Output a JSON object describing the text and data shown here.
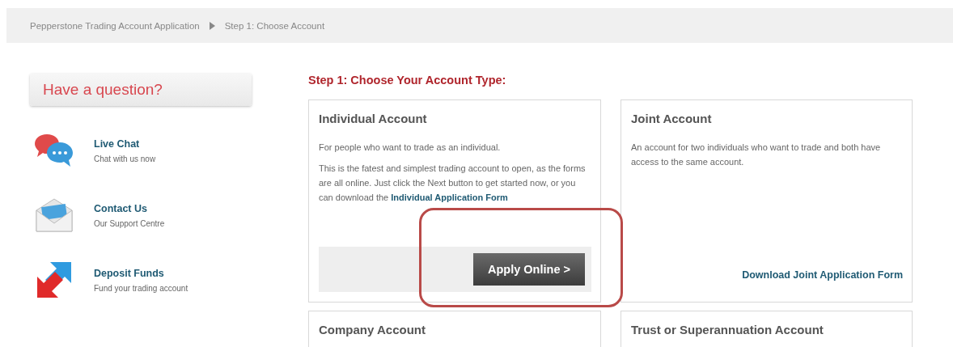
{
  "breadcrumb": [
    {
      "label": "Pepperstone Trading Account Application"
    },
    {
      "label": "Step 1: Choose Account"
    }
  ],
  "sidebar": {
    "title": "Have a question?",
    "items": [
      {
        "kind": "chat",
        "title": "Live Chat",
        "subtitle": "Chat with us now"
      },
      {
        "kind": "mail",
        "title": "Contact Us",
        "subtitle": "Our Support Centre"
      },
      {
        "kind": "transfer",
        "title": "Deposit Funds",
        "subtitle": "Fund your trading account"
      }
    ]
  },
  "heading": "Step 1: Choose Your Account Type:",
  "cards": [
    {
      "title": "Individual Account",
      "paragraphs": [
        {
          "text": "For people who want to trade as an individual."
        },
        {
          "text": "This is the fatest and simplest trading account to open, as the forms are all online. Just click the Next button to get started now, or you can download the",
          "link": "Individual Application Form"
        }
      ],
      "footer": {
        "kind": "button",
        "label": "Apply Online >"
      }
    },
    {
      "title": "Joint Account",
      "paragraphs": [
        {
          "text": "An account for two individuals who want to trade and both have access to the same account."
        }
      ],
      "footer": {
        "kind": "link",
        "label": "Download Joint Application Form"
      }
    },
    {
      "title": "Company Account"
    },
    {
      "title": "Trust or Superannuation Account"
    }
  ]
}
